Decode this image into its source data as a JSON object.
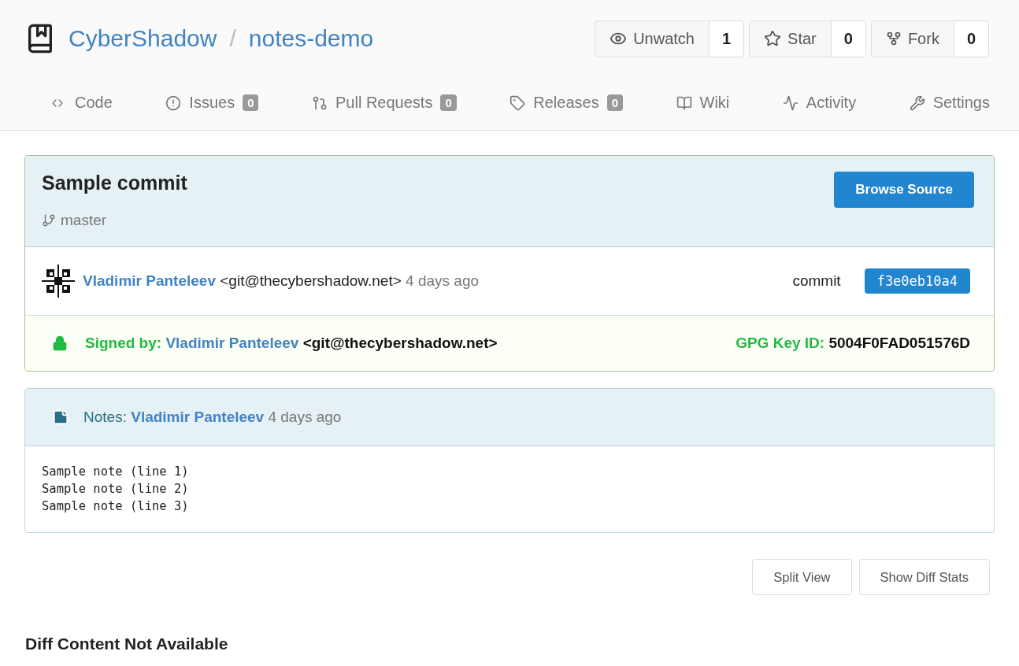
{
  "repo": {
    "owner": "CyberShadow",
    "separator": "/",
    "name": "notes-demo"
  },
  "actions": [
    {
      "kind": "watch",
      "label": "Unwatch",
      "count": "1"
    },
    {
      "kind": "star",
      "label": "Star",
      "count": "0"
    },
    {
      "kind": "fork",
      "label": "Fork",
      "count": "0"
    }
  ],
  "tabs": [
    {
      "kind": "code",
      "label": "Code",
      "selected": false
    },
    {
      "kind": "issues",
      "label": "Issues",
      "count": "0",
      "selected": false
    },
    {
      "kind": "pulls",
      "label": "Pull Requests",
      "count": "0",
      "selected": false
    },
    {
      "kind": "releases",
      "label": "Releases",
      "count": "0",
      "selected": false
    },
    {
      "kind": "wiki",
      "label": "Wiki",
      "selected": false
    },
    {
      "kind": "activity",
      "label": "Activity",
      "selected": false
    },
    {
      "kind": "settings",
      "label": "Settings",
      "selected": false
    }
  ],
  "commit": {
    "title": "Sample commit",
    "browse_button": "Browse Source",
    "branch": "master",
    "author": "Vladimir Panteleev",
    "email": "<git@thecybershadow.net>",
    "time": "4 days ago",
    "sha_label": "commit",
    "sha": "f3e0eb10a4"
  },
  "signature": {
    "label": "Signed by:",
    "signer": "Vladimir Panteleev",
    "email": "<git@thecybershadow.net>",
    "key_label": "GPG Key ID:",
    "key_id": "5004F0FAD051576D"
  },
  "notes": {
    "label": "Notes:",
    "author": "Vladimir Panteleev",
    "time": "4 days ago",
    "lines": [
      "Sample note (line 1)",
      "Sample note (line 2)",
      "Sample note (line 3)"
    ]
  },
  "diff_buttons": [
    "Split View",
    "Show Diff Stats"
  ],
  "diff_message": "Diff Content Not Available"
}
